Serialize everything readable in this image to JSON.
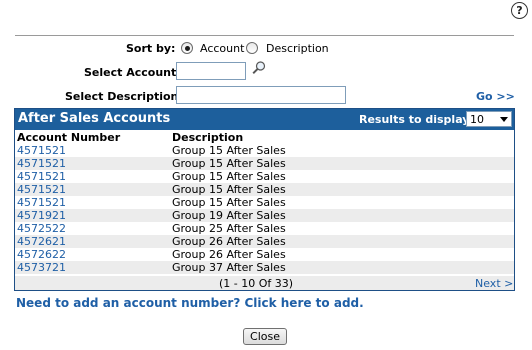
{
  "help": {
    "glyph": "?"
  },
  "sort": {
    "label": "Sort by:",
    "options": [
      "Account",
      "Description"
    ],
    "selected": "Account"
  },
  "select_account": {
    "label": "Select Account:",
    "value": ""
  },
  "select_description": {
    "label": "Select Description:",
    "value": ""
  },
  "go_label": "Go >>",
  "panel": {
    "title": "After Sales Accounts",
    "results_label": "Results to display:",
    "results_value": "10"
  },
  "table": {
    "columns": [
      "Account Number",
      "Description"
    ],
    "rows": [
      {
        "account": "4571521",
        "description": "Group 15 After Sales"
      },
      {
        "account": "4571521",
        "description": "Group 15 After Sales"
      },
      {
        "account": "4571521",
        "description": "Group 15 After Sales"
      },
      {
        "account": "4571521",
        "description": "Group 15 After Sales"
      },
      {
        "account": "4571521",
        "description": "Group 15 After Sales"
      },
      {
        "account": "4571921",
        "description": "Group 19 After Sales"
      },
      {
        "account": "4572522",
        "description": "Group 25 After Sales"
      },
      {
        "account": "4572621",
        "description": "Group 26 After Sales"
      },
      {
        "account": "4572622",
        "description": "Group 26 After Sales"
      },
      {
        "account": "4573721",
        "description": "Group 37 After Sales"
      }
    ]
  },
  "pagination": {
    "info": "(1 - 10 Of 33)",
    "next": "Next >"
  },
  "add_link": "Need to add an account number? Click here to add.",
  "close_label": "Close",
  "colors": {
    "header_bg": "#1d5f9c",
    "link": "#1f5fa6",
    "row_alt": "#ececec"
  }
}
